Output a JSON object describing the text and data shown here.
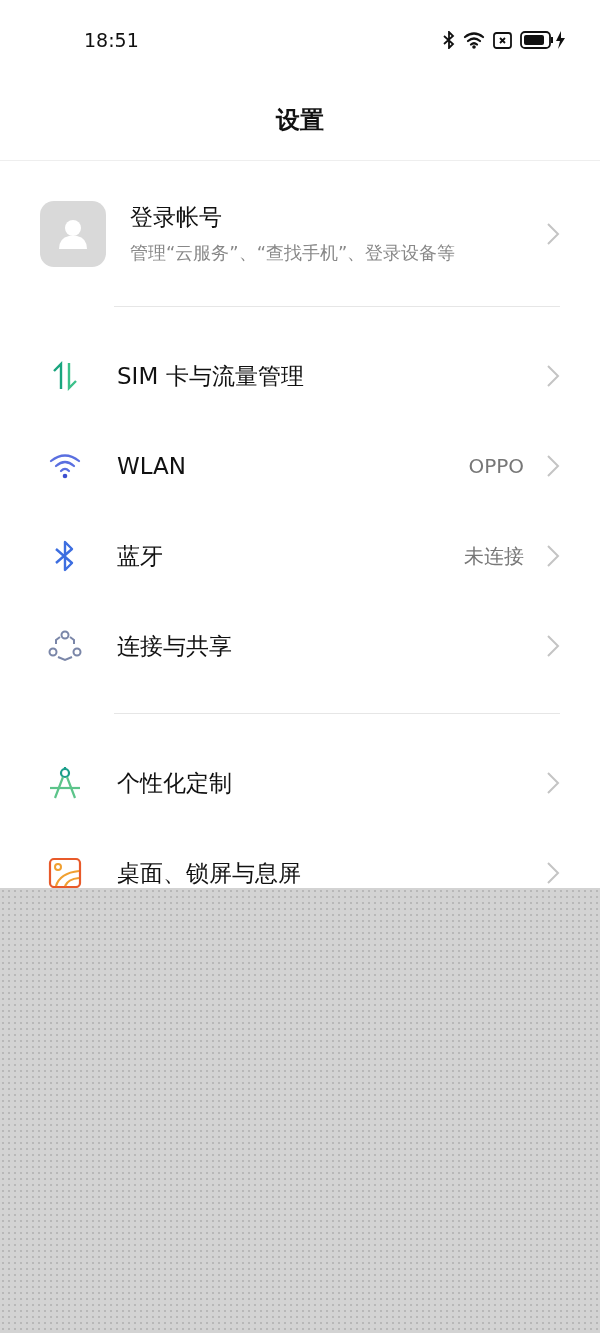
{
  "status_bar": {
    "time": "18:51"
  },
  "header": {
    "title": "设置"
  },
  "account": {
    "title": "登录帐号",
    "subtitle": "管理“云服务”、“查找手机”、登录设备等"
  },
  "groups": [
    {
      "items": [
        {
          "kind": "sim",
          "label": "SIM 卡与流量管理"
        },
        {
          "kind": "wlan",
          "label": "WLAN",
          "value": "OPPO"
        },
        {
          "kind": "bluetooth",
          "label": "蓝牙",
          "value": "未连接"
        },
        {
          "kind": "share",
          "label": "连接与共享"
        }
      ]
    },
    {
      "items": [
        {
          "kind": "personalize",
          "label": "个性化定制"
        },
        {
          "kind": "desktop",
          "label": "桌面、锁屏与息屏"
        }
      ]
    }
  ]
}
